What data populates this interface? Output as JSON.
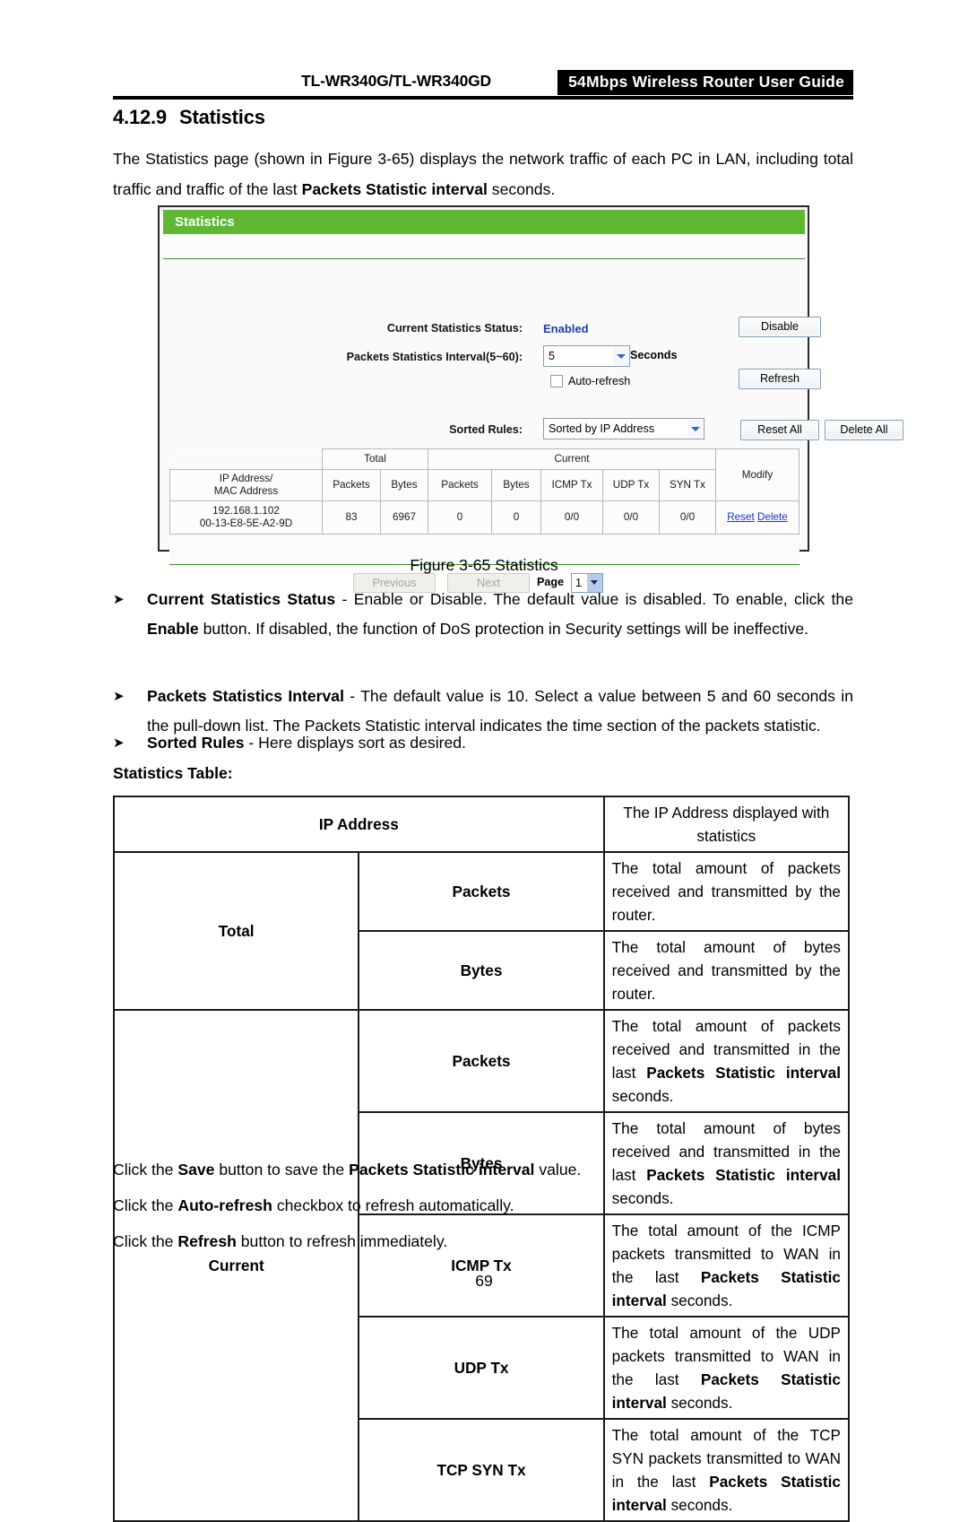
{
  "header": {
    "model": "TL-WR340G/TL-WR340GD",
    "guide": "54Mbps Wireless Router User Guide"
  },
  "section": {
    "number": "4.12.9",
    "title": "Statistics"
  },
  "intro": {
    "part1": "The Statistics page (shown in Figure 3-65) displays the network traffic of each PC in LAN, including total traffic and traffic of the last ",
    "bold": "Packets Statistic interval",
    "part2": " seconds."
  },
  "screenshot": {
    "panel_title": "Statistics",
    "labels": {
      "status": "Current Statistics Status:",
      "interval": "Packets Statistics Interval(5~60):",
      "seconds": "Seconds",
      "auto_refresh": "Auto-refresh",
      "sorted_rules": "Sorted Rules:"
    },
    "status_value": "Enabled",
    "interval_value": "5",
    "sorted_value": "Sorted by IP Address",
    "buttons": {
      "disable": "Disable",
      "refresh": "Refresh",
      "reset_all": "Reset All",
      "delete_all": "Delete All",
      "previous": "Previous",
      "next": "Next"
    },
    "table": {
      "group_total": "Total",
      "group_current": "Current",
      "modify": "Modify",
      "ip_mac_line1": "IP Address/",
      "ip_mac_line2": "MAC Address",
      "columns": {
        "total_packets": "Packets",
        "total_bytes": "Bytes",
        "cur_packets": "Packets",
        "cur_bytes": "Bytes",
        "icmp_tx": "ICMP Tx",
        "udp_tx": "UDP Tx",
        "syn_tx": "SYN Tx"
      },
      "row": {
        "ip": "192.168.1.102",
        "mac": "00-13-E8-5E-A2-9D",
        "total_packets": "83",
        "total_bytes": "6967",
        "cur_packets": "0",
        "cur_bytes": "0",
        "icmp_tx": "0/0",
        "udp_tx": "0/0",
        "syn_tx": "0/0",
        "reset": "Reset",
        "delete": "Delete"
      }
    },
    "pager": {
      "page_label": "Page",
      "page_value": "1"
    },
    "colors": {
      "panel_green": "#5fb733",
      "status_blue": "#1a3fa0",
      "link_blue": "#1e2fd0"
    }
  },
  "figure_caption": "Figure 3-65 Statistics",
  "bullets": [
    {
      "marker": "➤",
      "term": "Current Statistics Status",
      "sep": " - ",
      "text_a": "Enable or Disable. The default value is disabled. To enable, click the ",
      "term2": "Enable",
      "text_b": " button. If disabled, the function of DoS protection in Security settings will be ineffective."
    },
    {
      "marker": "➤",
      "term": "Packets Statistics Interval",
      "sep": " - ",
      "text_a": "The default value is 10. Select a value between 5 and 60 seconds in the pull-down list. The Packets Statistic interval indicates the time section of the packets statistic."
    },
    {
      "marker": "➤",
      "term": "Sorted Rules",
      "sep": " - ",
      "text_a": "Here displays sort as desired."
    }
  ],
  "stats_table_title": "Statistics Table:",
  "stats_table": {
    "ip_address_key": "IP Address",
    "ip_address_desc": "The IP Address displayed with statistics",
    "total_group": "Total",
    "current_group": "Current",
    "rows": [
      {
        "key": "Packets",
        "desc_a": "The total amount of packets received and transmitted by the router.",
        "bold": "",
        "desc_b": ""
      },
      {
        "key": "Bytes",
        "desc_a": "The total amount of bytes received and transmitted by the router.",
        "bold": "",
        "desc_b": ""
      },
      {
        "key": "Packets",
        "desc_a": "The total amount of packets received and transmitted in the last ",
        "bold": "Packets Statistic interval",
        "desc_b": " seconds."
      },
      {
        "key": "Bytes",
        "desc_a": "The total amount of bytes received and transmitted in the last ",
        "bold": "Packets Statistic interval",
        "desc_b": " seconds."
      },
      {
        "key": "ICMP Tx",
        "desc_a": "The total amount of the ICMP packets transmitted to WAN in the last ",
        "bold": "Packets Statistic interval",
        "desc_b": " seconds."
      },
      {
        "key": "UDP Tx",
        "desc_a": "The total amount of the UDP packets transmitted to WAN in the last ",
        "bold": "Packets Statistic interval",
        "desc_b": " seconds."
      },
      {
        "key": "TCP SYN Tx",
        "desc_a": "The total amount of the TCP SYN packets transmitted to WAN in the last ",
        "bold": "Packets Statistic interval",
        "desc_b": " seconds."
      }
    ]
  },
  "closing": {
    "save_a": "Click the ",
    "save_b": "Save",
    "save_c": " button to save the ",
    "save_d": "Packets Statistic interval",
    "save_e": " value.",
    "auto_a": "Click the ",
    "auto_b": "Auto-refresh",
    "auto_c": " checkbox to refresh automatically.",
    "ref_a": "Click the ",
    "ref_b": "Refresh",
    "ref_c": " button to refresh immediately."
  },
  "page_number": "69"
}
